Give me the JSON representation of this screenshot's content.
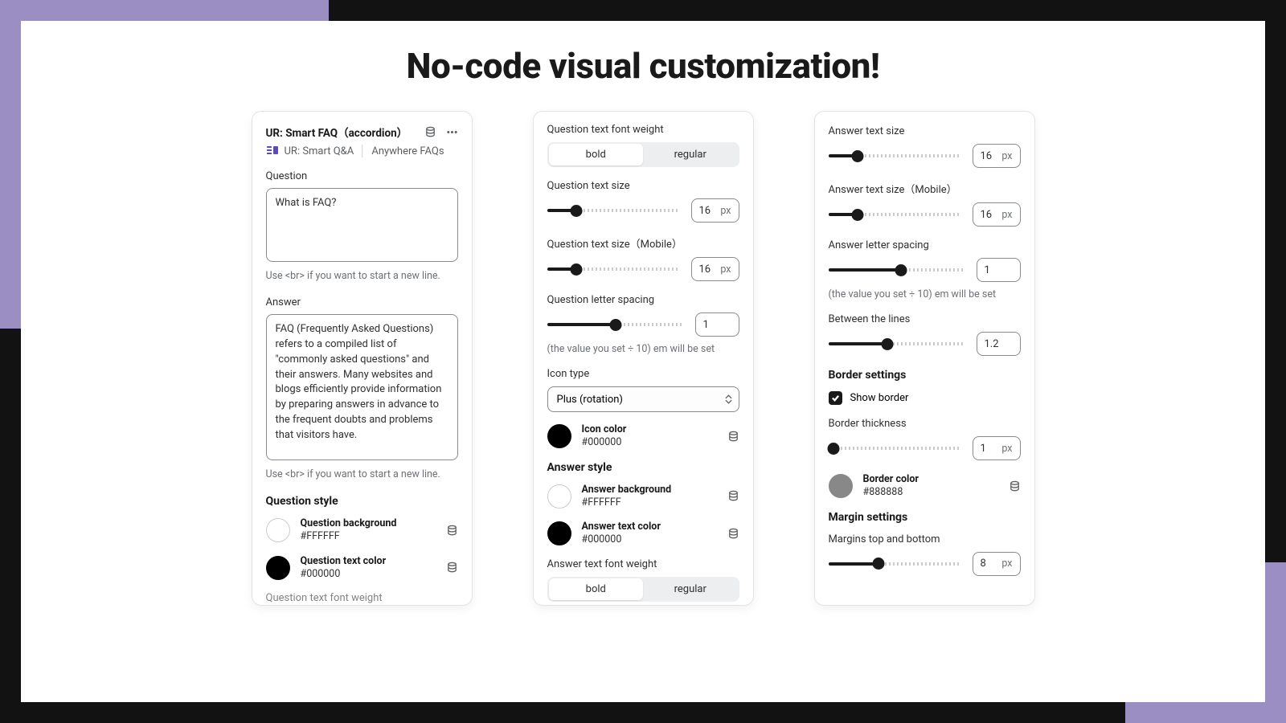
{
  "page": {
    "title": "No-code visual customization!"
  },
  "block": {
    "title": "UR: Smart FAQ（accordion）",
    "breadcrumb_app": "UR: Smart Q&A",
    "breadcrumb_loc": "Anywhere FAQs"
  },
  "question": {
    "label": "Question",
    "value": "What is FAQ?",
    "hint": "Use <br> if you want to start a new line."
  },
  "answer": {
    "label": "Answer",
    "value": "FAQ (Frequently Asked Questions) refers to a compiled list of \"commonly asked questions\" and their answers. Many websites and blogs efficiently provide information by preparing answers in advance to the frequent doubts and problems that visitors have.",
    "hint": "Use <br> if you want to start a new line."
  },
  "q_style": {
    "section": "Question style",
    "bg_name": "Question background",
    "bg_hex": "#FFFFFF",
    "tc_name": "Question text color",
    "tc_hex": "#000000",
    "truncated": "Question text font weight"
  },
  "mid": {
    "q_weight_label": "Question text font weight",
    "bold": "bold",
    "regular": "regular",
    "q_size_label": "Question text size",
    "q_size_val": "16",
    "q_size_unit": "px",
    "q_size_m_label": "Question text size（Mobile）",
    "q_size_m_val": "16",
    "q_size_m_unit": "px",
    "q_ls_label": "Question letter spacing",
    "q_ls_val": "1",
    "q_ls_hint": "(the value you set ÷ 10) em will be set",
    "icon_type_label": "Icon type",
    "icon_type_val": "Plus (rotation)",
    "icon_color_name": "Icon color",
    "icon_color_hex": "#000000",
    "a_style_section": "Answer style",
    "a_bg_name": "Answer background",
    "a_bg_hex": "#FFFFFF",
    "a_tc_name": "Answer text color",
    "a_tc_hex": "#000000",
    "a_weight_label": "Answer text font weight"
  },
  "right": {
    "a_size_label": "Answer text size",
    "a_size_val": "16",
    "a_size_unit": "px",
    "a_size_m_label": "Answer text size（Mobile）",
    "a_size_m_val": "16",
    "a_size_m_unit": "px",
    "a_ls_label": "Answer letter spacing",
    "a_ls_val": "1",
    "a_ls_hint": "(the value you set ÷ 10) em will be set",
    "btw_label": "Between the lines",
    "btw_val": "1.2",
    "border_section": "Border settings",
    "show_border_label": "Show border",
    "border_thick_label": "Border thickness",
    "border_thick_val": "1",
    "border_thick_unit": "px",
    "border_color_name": "Border color",
    "border_color_hex": "#888888",
    "margin_section": "Margin settings",
    "margins_tb_label": "Margins top and bottom",
    "margins_tb_val": "8",
    "margins_tb_unit": "px"
  }
}
